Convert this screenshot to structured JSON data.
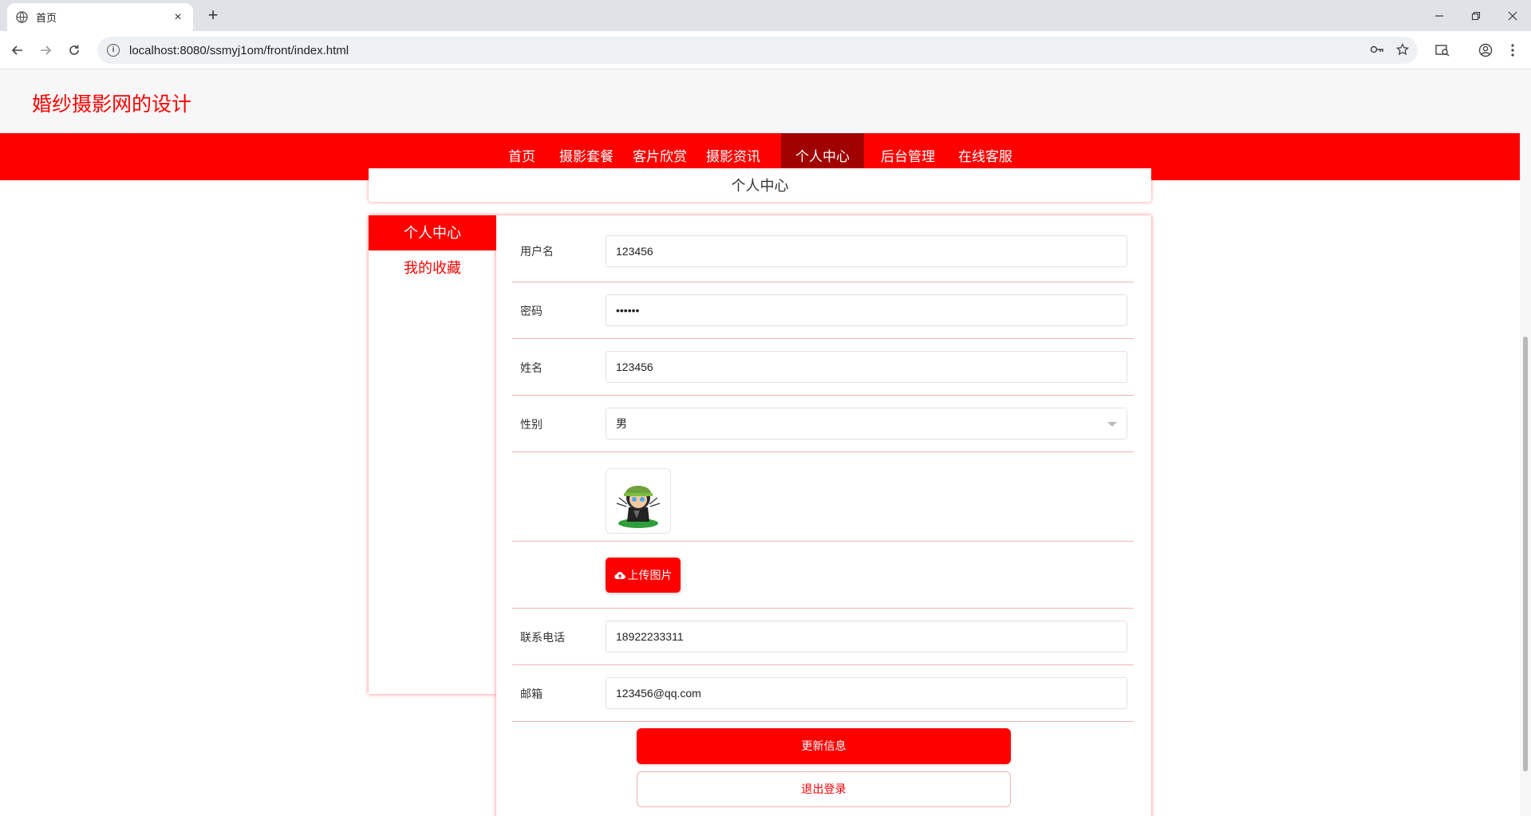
{
  "browser": {
    "tab_title": "首页",
    "url": "localhost:8080/ssmyj1om/front/index.html",
    "new_tab": "+",
    "close_tab": "×"
  },
  "site": {
    "title": "婚纱摄影网的设计",
    "nav": [
      {
        "label": "首页",
        "active": false
      },
      {
        "label": "摄影套餐",
        "active": false
      },
      {
        "label": "客片欣赏",
        "active": false
      },
      {
        "label": "摄影资讯",
        "active": false
      },
      {
        "label": "个人中心",
        "active": true
      },
      {
        "label": "后台管理",
        "active": false
      },
      {
        "label": "在线客服",
        "active": false
      }
    ],
    "page_heading": "个人中心"
  },
  "sidebar": {
    "items": [
      {
        "label": "个人中心",
        "active": true
      },
      {
        "label": "我的收藏",
        "active": false
      }
    ]
  },
  "form": {
    "username": {
      "label": "用户名",
      "value": "123456"
    },
    "password": {
      "label": "密码",
      "value": "••••••"
    },
    "name": {
      "label": "姓名",
      "value": "123456"
    },
    "gender": {
      "label": "性别",
      "value": "男"
    },
    "upload_label": "上传图片",
    "phone": {
      "label": "联系电话",
      "value": "18922233311"
    },
    "email": {
      "label": "邮箱",
      "value": "123456@qq.com"
    },
    "update_button": "更新信息",
    "logout_button": "退出登录"
  },
  "colors": {
    "primary": "#ff0000",
    "nav_active": "#a00000",
    "header_bg": "#f7f7f7",
    "row_border": "#f3b2b2"
  },
  "icons": {
    "favicon": "globe-icon",
    "back": "arrow-left-icon",
    "forward": "arrow-right-icon",
    "reload": "reload-icon",
    "site_info": "info-icon",
    "password_manager": "key-icon",
    "bookmark": "star-icon",
    "tab_search": "tab-search-icon",
    "profile": "profile-icon",
    "menu": "kebab-menu-icon",
    "upload": "cloud-upload-icon",
    "select": "chevron-down-icon"
  }
}
